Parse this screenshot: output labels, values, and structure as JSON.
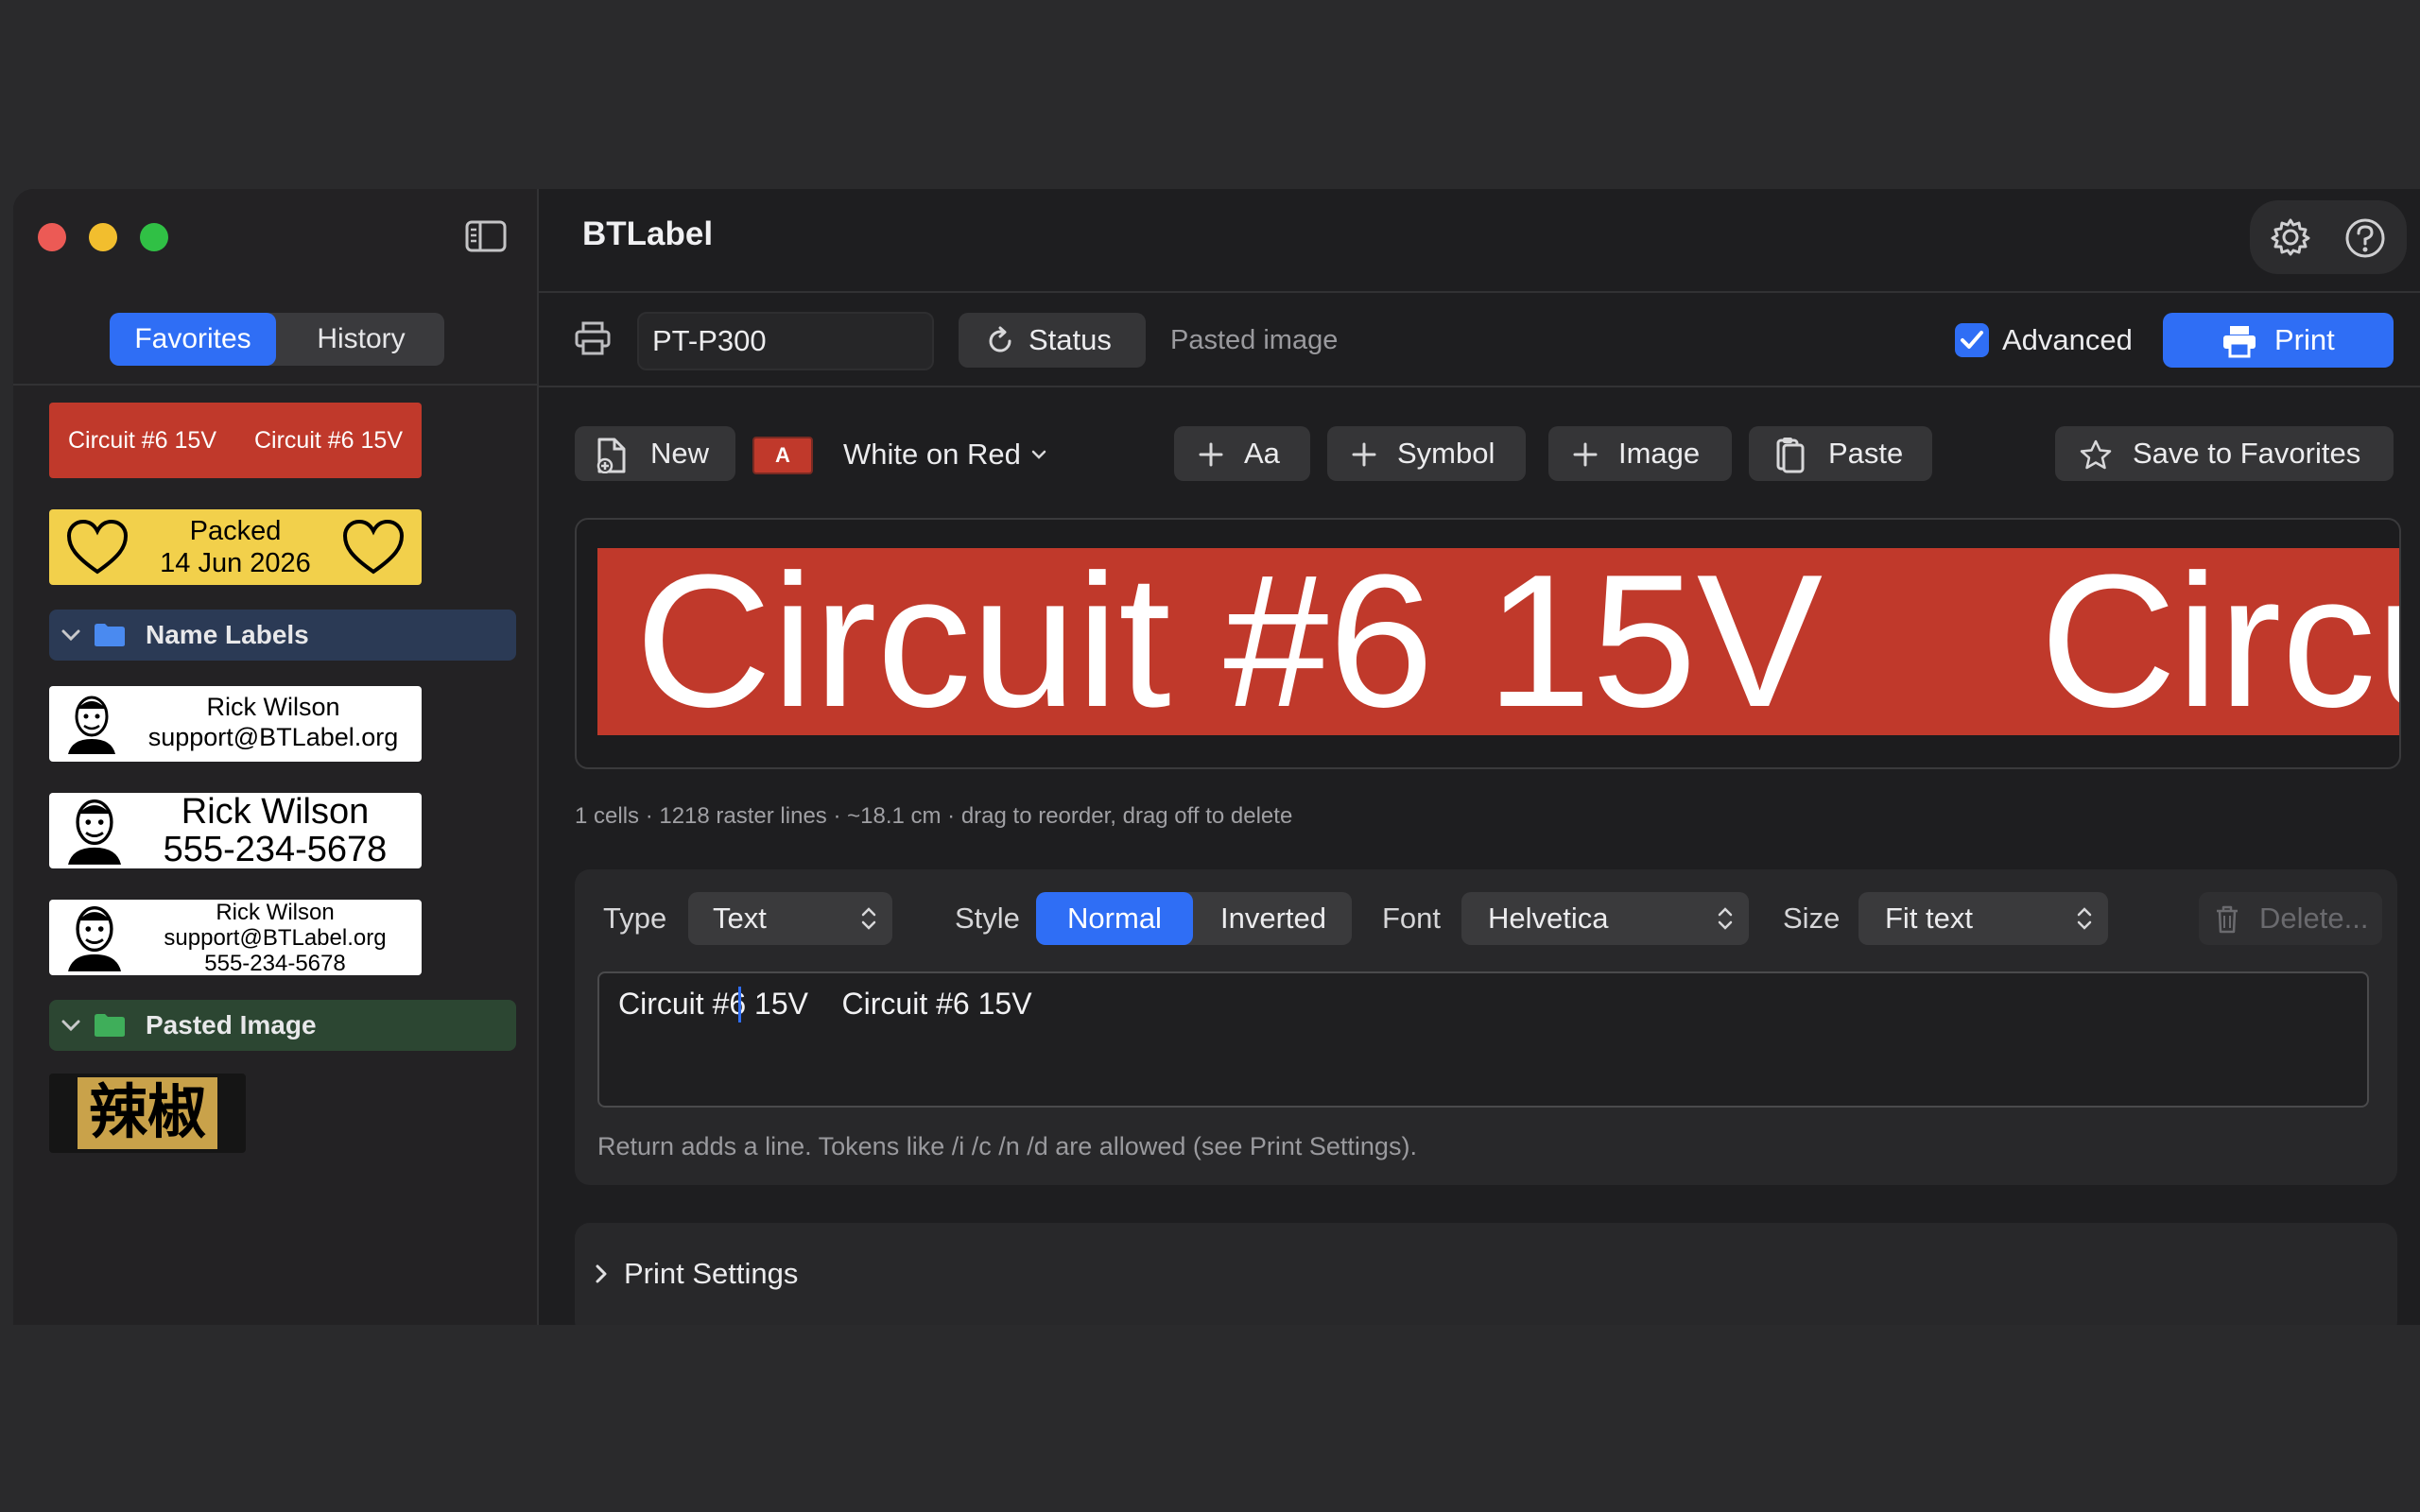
{
  "app": {
    "title": "BTLabel"
  },
  "sidebar": {
    "tabs": [
      "Favorites",
      "History"
    ],
    "active_tab": "Favorites",
    "favorites": [
      {
        "texts": [
          "Circuit #6 15V",
          "Circuit #6 15V"
        ],
        "bg": "#c0392b",
        "fg": "#ffffff"
      },
      {
        "texts": [
          "Packed",
          "14 Jun 2026"
        ],
        "bg": "#f2d04b",
        "fg": "#000000"
      }
    ],
    "folders": [
      {
        "name": "Name Labels",
        "color": "#2b3a55",
        "items": [
          {
            "lines": [
              "Rick Wilson",
              "support@BTLabel.org"
            ]
          },
          {
            "lines": [
              "Rick Wilson",
              "555-234-5678"
            ]
          },
          {
            "lines": [
              "Rick Wilson",
              "support@BTLabel.org",
              "555-234-5678"
            ]
          }
        ]
      },
      {
        "name": "Pasted Image",
        "color": "#2c4632",
        "items": [
          {
            "text": "辣椒",
            "bg": "#c9a24a"
          }
        ]
      }
    ]
  },
  "toolbar": {
    "printer": "PT-P300",
    "status_label": "Status",
    "status_text": "Pasted image",
    "advanced_label": "Advanced",
    "advanced_checked": true,
    "print_label": "Print"
  },
  "actions": {
    "new_label": "New",
    "style_badge": "A",
    "style_name": "White on Red",
    "add_text_label": "Aa",
    "symbol_label": "Symbol",
    "image_label": "Image",
    "paste_label": "Paste",
    "save_favorites_label": "Save to Favorites"
  },
  "preview": {
    "texts": [
      "Circuit #6 15V",
      "Circu"
    ],
    "info": "1 cells · 1218 raster lines · ~18.1 cm · drag to reorder, drag off to delete"
  },
  "editor": {
    "type_label": "Type",
    "type_value": "Text",
    "style_label": "Style",
    "style_options": [
      "Normal",
      "Inverted"
    ],
    "style_selected": "Normal",
    "font_label": "Font",
    "font_value": "Helvetica",
    "size_label": "Size",
    "size_value": "Fit text",
    "delete_label": "Delete...",
    "text_value": "Circuit #6 15V    Circuit #6 15V",
    "hint": "Return adds a line. Tokens like /i /c /n /d are allowed (see Print Settings)."
  },
  "print_settings": {
    "label": "Print Settings"
  },
  "colors": {
    "accent": "#2f6ef5",
    "label_red": "#c0392b",
    "label_yellow": "#f2d04b"
  }
}
